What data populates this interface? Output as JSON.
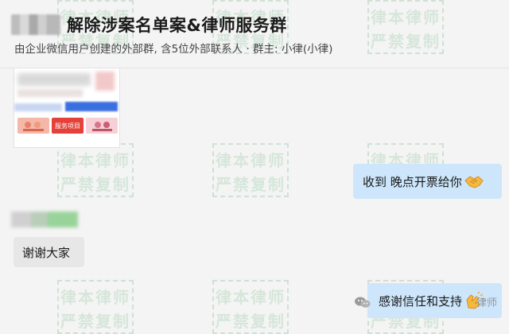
{
  "header": {
    "title": "解除涉案名单案&律师服务群",
    "subtitle": "由企业微信用户创建的外部群, 含5位外部联系人 · 群主: 小律(小律)"
  },
  "watermark": {
    "line1": "律本律师",
    "line2": "严禁复制"
  },
  "card": {
    "thumbs": [
      {
        "color": "#f4b8a8",
        "label": ""
      },
      {
        "color": "#e5403a",
        "label": "服务项目"
      },
      {
        "color": "#f7cfd6",
        "label": ""
      }
    ]
  },
  "messages": [
    {
      "side": "right",
      "text": "收到 晚点开票给你",
      "emoji": "handshake-emoji"
    },
    {
      "side": "left",
      "text": "谢谢大家"
    },
    {
      "side": "right",
      "text": "感谢信任和支持",
      "emoji": "clapping-hands-emoji"
    }
  ],
  "footer_mark": {
    "text": "律师"
  },
  "colors": {
    "bubble_right": "#cde6fb",
    "bubble_left": "#e7e7e7",
    "watermark": "#d6e6da"
  }
}
